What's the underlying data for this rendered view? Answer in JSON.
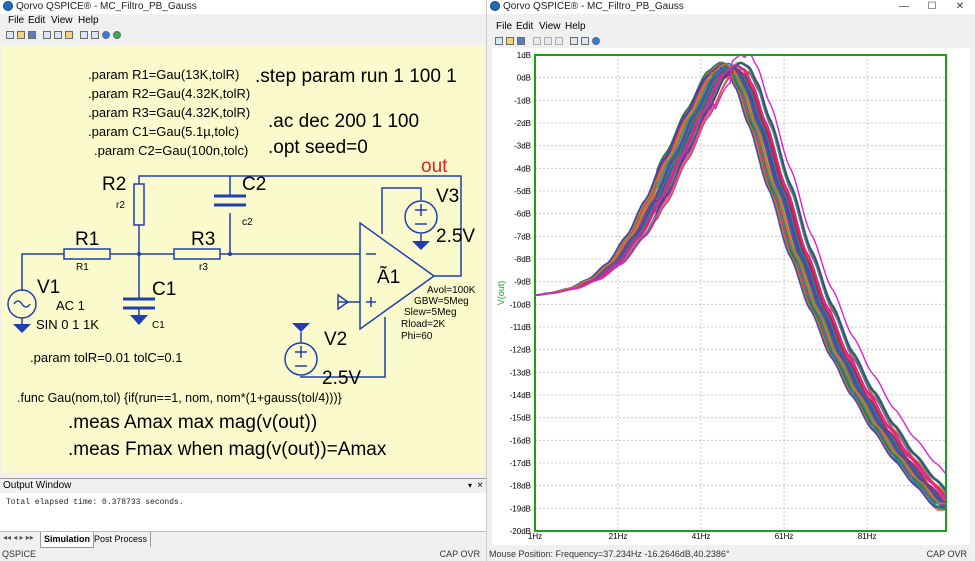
{
  "left_window": {
    "title": "Qorvo QSPICE® - MC_Filtro_PB_Gauss",
    "menu": [
      "File",
      "Edit",
      "View",
      "Help"
    ],
    "schematic": {
      "directives": {
        "param_r1": ".param R1=Gau(13K,tolR)",
        "param_r2": ".param R2=Gau(4.32K,tolR)",
        "param_r3": ".param R3=Gau(4.32K,tolR)",
        "param_c1": ".param C1=Gau(5.1µ,tolc)",
        "param_c2": ".param C2=Gau(100n,tolc)",
        "step": ".step param run 1 100 1",
        "ac": ".ac dec 200 1 100",
        "opt": ".opt seed=0",
        "param_tol": ".param tolR=0.01 tolC=0.1",
        "func": ".func Gau(nom,tol) {if(run==1, nom, nom*(1+gauss(tol/4)))}",
        "meas1": ".meas Amax max mag(v(out))",
        "meas2": ".meas Fmax when mag(v(out))=Amax"
      },
      "components": {
        "r1_name": "R1",
        "r1_value": "R1",
        "r2_name": "R2",
        "r2_value": "r2",
        "r3_name": "R3",
        "r3_value": "r3",
        "c1_name": "C1",
        "c1_value": "C1",
        "c2_name": "C2",
        "c2_value": "c2",
        "v1_name": "V1",
        "v1_ac": "AC 1",
        "v1_sin": "SIN 0 1 1K",
        "v2_name": "V2",
        "v2_value": "2.5V",
        "v3_name": "V3",
        "v3_value": "2.5V",
        "a1_name": "Ã1",
        "a1_params": [
          "Avol=100K",
          "GBW=5Meg",
          "Slew=5Meg",
          "Rload=2K",
          "Phi=60"
        ],
        "net_out": "out"
      }
    },
    "output_window": {
      "title": "Output Window",
      "text": "Total elapsed time: 0.378733 seconds."
    },
    "tabs": [
      "Simulation",
      "Post Process"
    ],
    "status_left": "QSPICE",
    "status_right": "CAP OVR"
  },
  "right_window": {
    "title": "Qorvo QSPICE® - MC_Filtro_PB_Gauss",
    "menu": [
      "File",
      "Edit",
      "View",
      "Help"
    ],
    "status_mouse": "Mouse Position: Frequency=37.234Hz   -16.2646dB,40.2386°",
    "status_right": "CAP OVR"
  },
  "chart_data": {
    "type": "line",
    "ylabel": "V(out)",
    "x_ticks": [
      "1Hz",
      "21Hz",
      "41Hz",
      "61Hz",
      "81Hz"
    ],
    "xlim": [
      1,
      100
    ],
    "y_ticks": [
      "1dB",
      "0dB",
      "-1dB",
      "-2dB",
      "-3dB",
      "-4dB",
      "-5dB",
      "-6dB",
      "-7dB",
      "-8dB",
      "-9dB",
      "-10dB",
      "-11dB",
      "-12dB",
      "-13dB",
      "-14dB",
      "-15dB",
      "-16dB",
      "-17dB",
      "-18dB",
      "-19dB",
      "-20dB"
    ],
    "ylim": [
      -20,
      1
    ],
    "grid": true,
    "nominal_series": {
      "x": [
        1,
        5,
        10,
        15,
        20,
        25,
        30,
        35,
        40,
        45,
        48,
        50,
        52,
        55,
        60,
        65,
        70,
        75,
        80,
        85,
        90,
        95,
        100
      ],
      "y": [
        -9.6,
        -9.5,
        -9.3,
        -8.9,
        -8.2,
        -7.0,
        -5.4,
        -3.5,
        -1.6,
        0.1,
        0.5,
        0.3,
        -0.4,
        -2.0,
        -4.9,
        -7.8,
        -10.2,
        -12.3,
        -14.0,
        -15.5,
        -16.8,
        -17.9,
        -18.9
      ]
    },
    "series_count": 100,
    "series_colors": [
      "#e45c28",
      "#1b7a3a",
      "#1f5fbf",
      "#7a3aa8",
      "#0f8f8f",
      "#c21f3a",
      "#d77a1b",
      "#2a9d4b",
      "#3b3bb0",
      "#e0209a"
    ]
  }
}
